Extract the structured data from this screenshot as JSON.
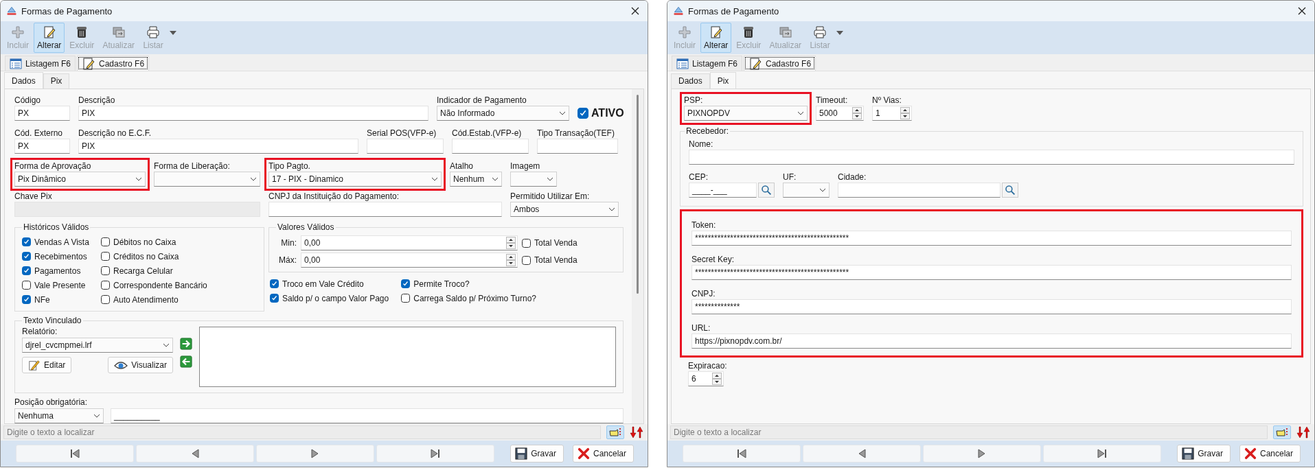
{
  "windows": [
    {
      "title": "Formas de Pagamento",
      "toolbar": [
        {
          "label": "Incluir",
          "disabled": true,
          "selected": false
        },
        {
          "label": "Alterar",
          "disabled": false,
          "selected": true
        },
        {
          "label": "Excluir",
          "disabled": true,
          "selected": false
        },
        {
          "label": "Atualizar",
          "disabled": true,
          "selected": false
        },
        {
          "label": "Listar",
          "disabled": true,
          "selected": false
        }
      ],
      "views": [
        {
          "label": "Listagem F6",
          "selected": false
        },
        {
          "label": "Cadastro F6",
          "selected": true
        }
      ],
      "tabs": [
        {
          "label": "Dados",
          "selected": true
        },
        {
          "label": "Pix",
          "selected": false
        }
      ],
      "form": {
        "kind": "dados",
        "rows": [
          [
            {
              "kind": "text",
              "label": "Código",
              "value": "PX",
              "highlighted": false
            },
            {
              "kind": "text",
              "label": "Descrição",
              "value": "PIX",
              "highlighted": false
            },
            {
              "kind": "select",
              "label": "Indicador de Pagamento",
              "value": "Não Informado",
              "highlighted": false
            },
            {
              "kind": "status",
              "label": "ATIVO",
              "checked": true,
              "highlighted": false
            }
          ],
          [
            {
              "kind": "text",
              "label": "Cód. Externo",
              "value": "PX",
              "highlighted": false
            },
            {
              "kind": "text",
              "label": "Descrição no E.C.F.",
              "value": "PIX",
              "highlighted": false
            },
            {
              "kind": "text",
              "label": "Serial POS(VFP-e)",
              "highlighted": false
            },
            {
              "kind": "text",
              "label": "Cód.Estab.(VFP-e)",
              "highlighted": false
            },
            {
              "kind": "text",
              "label": "Tipo Transação(TEF)",
              "highlighted": false
            }
          ],
          [
            {
              "kind": "select",
              "label": "Forma de Aprovação",
              "value": "Pix Dinâmico",
              "highlighted": true
            },
            {
              "kind": "select",
              "label": "Forma de Liberação:",
              "highlighted": false
            },
            {
              "kind": "select",
              "label": "Tipo Pagto.",
              "value": "17 - PIX - Dinamico",
              "highlighted": true
            },
            {
              "kind": "select",
              "label": "Atalho",
              "value": "Nenhum",
              "highlighted": false
            },
            {
              "kind": "select",
              "label": "Imagem",
              "highlighted": false
            }
          ],
          [
            {
              "kind": "locked",
              "label": "Chave Pix",
              "highlighted": false
            },
            {
              "kind": "text",
              "label": "CNPJ da Instituição do Pagamento:",
              "highlighted": false
            },
            {
              "kind": "select",
              "label": "Permitido Utilizar Em:",
              "value": "Ambos",
              "highlighted": false
            }
          ]
        ],
        "historicos": {
          "title": "Históricos Válidos",
          "items": [
            {
              "label": "Vendas A Vista",
              "checked": true
            },
            {
              "label": "Débitos no Caixa",
              "checked": false
            },
            {
              "label": "Recebimentos",
              "checked": true
            },
            {
              "label": "Créditos no Caixa",
              "checked": false
            },
            {
              "label": "Pagamentos",
              "checked": true
            },
            {
              "label": "Recarga Celular",
              "checked": false
            },
            {
              "label": "Vale Presente",
              "checked": false
            },
            {
              "label": "Correspondente Bancário",
              "checked": false
            },
            {
              "label": "NFe",
              "checked": true
            },
            {
              "label": "Auto Atendimento",
              "checked": false
            }
          ]
        },
        "valores": {
          "title": "Valores Válidos",
          "rows": [
            {
              "label": "Min:",
              "value": "0,00",
              "check_label": "Total Venda",
              "checked": false
            },
            {
              "label": "Máx:",
              "value": "0,00",
              "check_label": "Total Venda",
              "checked": false
            }
          ]
        },
        "options": [
          {
            "label": "Troco em Vale Crédito",
            "checked": true
          },
          {
            "label": "Permite Troco?",
            "checked": true
          },
          {
            "label": "Saldo p/ o campo Valor Pago",
            "checked": true
          },
          {
            "label": "Carrega Saldo p/ Próximo Turno?",
            "checked": false
          }
        ],
        "texto": {
          "title": "Texto Vinculado",
          "report_label": "Relatório:",
          "report": "djrel_cvcmpmei.lrf",
          "buttons": [
            "Editar",
            "Visualizar"
          ]
        },
        "posicao": {
          "label": "Posição obrigatória:",
          "value": "Nenhuma",
          "mask": "__________"
        }
      },
      "search": {
        "placeholder": "Digite o texto a localizar"
      },
      "actions": [
        "Gravar",
        "Cancelar"
      ]
    },
    {
      "title": "Formas de Pagamento",
      "toolbar": [
        {
          "label": "Incluir",
          "disabled": true,
          "selected": false
        },
        {
          "label": "Alterar",
          "disabled": false,
          "selected": true
        },
        {
          "label": "Excluir",
          "disabled": true,
          "selected": false
        },
        {
          "label": "Atualizar",
          "disabled": true,
          "selected": false
        },
        {
          "label": "Listar",
          "disabled": true,
          "selected": false
        }
      ],
      "views": [
        {
          "label": "Listagem F6",
          "selected": false
        },
        {
          "label": "Cadastro F6",
          "selected": true
        }
      ],
      "tabs": [
        {
          "label": "Dados",
          "selected": false
        },
        {
          "label": "Pix",
          "selected": true
        }
      ],
      "form": {
        "kind": "pix",
        "top": [
          {
            "kind": "select",
            "label": "PSP:",
            "value": "PIXNOPDV",
            "highlighted": true
          },
          {
            "kind": "spin",
            "label": "Timeout:",
            "value": "5000",
            "highlighted": false
          },
          {
            "kind": "spin",
            "label": "Nº Vias:",
            "value": "1",
            "highlighted": false
          }
        ],
        "recebedor": {
          "title": "Recebedor:",
          "rows": [
            [
              {
                "kind": "text",
                "label": "Nome:"
              }
            ],
            [
              {
                "kind": "search",
                "label": "CEP:",
                "value": "____-___"
              },
              {
                "kind": "select",
                "label": "UF:"
              },
              {
                "kind": "search",
                "label": "Cidade:"
              }
            ]
          ]
        },
        "credentials": {
          "highlighted": true,
          "fields": [
            {
              "kind": "text",
              "label": "Token:",
              "value": "************************************************"
            },
            {
              "kind": "text",
              "label": "Secret Key:",
              "value": "************************************************"
            },
            {
              "kind": "text",
              "label": "CNPJ:",
              "value": "**************"
            },
            {
              "kind": "text",
              "label": "URL:",
              "value": "https://pixnopdv.com.br/"
            }
          ]
        },
        "expiracao": {
          "kind": "spin",
          "label": "Expiracao:",
          "value": "6"
        }
      },
      "search": {
        "placeholder": "Digite o texto a localizar"
      },
      "actions": [
        "Gravar",
        "Cancelar"
      ]
    }
  ]
}
